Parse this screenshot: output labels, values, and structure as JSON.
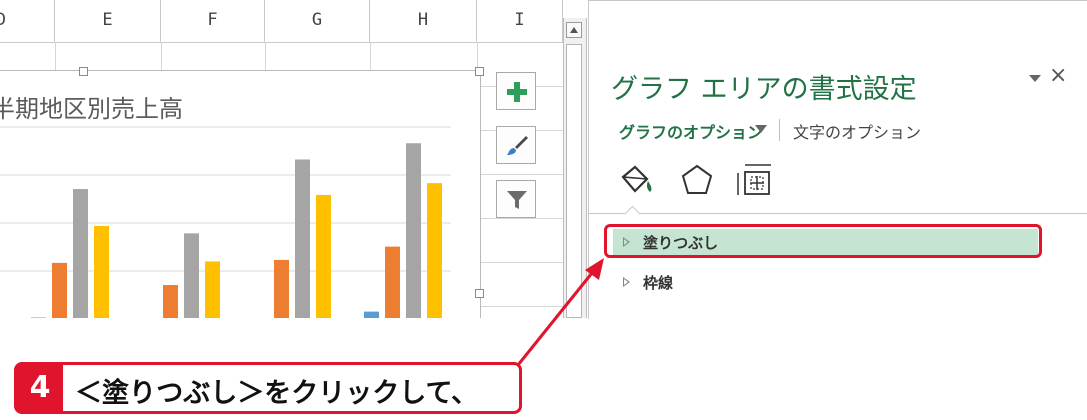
{
  "sheet": {
    "columns": [
      "D",
      "E",
      "F",
      "G",
      "H",
      "I"
    ]
  },
  "chart": {
    "title": "半期地区別売上高",
    "buttons": [
      "add-element-icon",
      "brush-icon",
      "filter-icon"
    ]
  },
  "chart_data": {
    "type": "bar",
    "title": "半期地区別売上高",
    "categories": [
      "",
      "",
      "",
      ""
    ],
    "series": [
      {
        "values": [
          1,
          0,
          0,
          5
        ],
        "color": "#5b9bd5"
      },
      {
        "values": [
          38,
          23,
          40,
          49
        ],
        "color": "#ed7d31"
      },
      {
        "values": [
          88,
          58,
          108,
          119
        ],
        "color": "#a5a5a5"
      },
      {
        "values": [
          63,
          39,
          84,
          92
        ],
        "color": "#ffc000"
      }
    ],
    "ylim": [
      0,
      130
    ],
    "grid": true
  },
  "pane": {
    "title": "グラフ エリアの書式設定",
    "close_label": "×",
    "tab_graph_options": "グラフのオプション",
    "tab_text_options": "文字のオプション",
    "icons": [
      "fill-line-icon",
      "effects-icon",
      "size-properties-icon"
    ],
    "sections": [
      {
        "label": "塗りつぶし"
      },
      {
        "label": "枠線"
      }
    ]
  },
  "callout": {
    "step": "4",
    "text": "＜塗りつぶし＞をクリックして、",
    "accent": "#e0152d"
  }
}
